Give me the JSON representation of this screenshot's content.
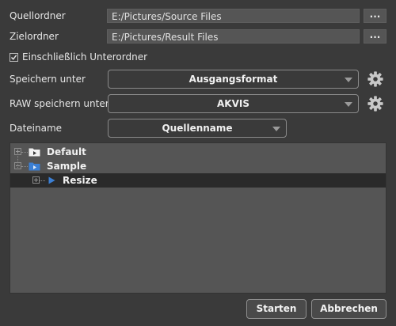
{
  "source": {
    "label": "Quellordner",
    "path": "E:/Pictures/Source Files",
    "browse": "..."
  },
  "target": {
    "label": "Zielordner",
    "path": "E:/Pictures/Result Files",
    "browse": "..."
  },
  "subfolders": {
    "label": "Einschließlich Unterordner",
    "checked": true
  },
  "save_as": {
    "label": "Speichern unter",
    "value": "Ausgangsformat"
  },
  "raw_save_as": {
    "label": "RAW speichern unter",
    "value": "AKVIS"
  },
  "filename": {
    "label": "Dateiname",
    "value": "Quellenname"
  },
  "tree": {
    "items": [
      {
        "label": "Default",
        "type": "folder"
      },
      {
        "label": "Sample",
        "type": "folder"
      },
      {
        "label": "Resize",
        "type": "action"
      }
    ]
  },
  "buttons": {
    "start": "Starten",
    "cancel": "Abbrechen"
  },
  "colors": {
    "background": "#3a3a3a",
    "field": "#555555",
    "selection": "#2a2a2a",
    "accent": "#3b7fd4"
  }
}
